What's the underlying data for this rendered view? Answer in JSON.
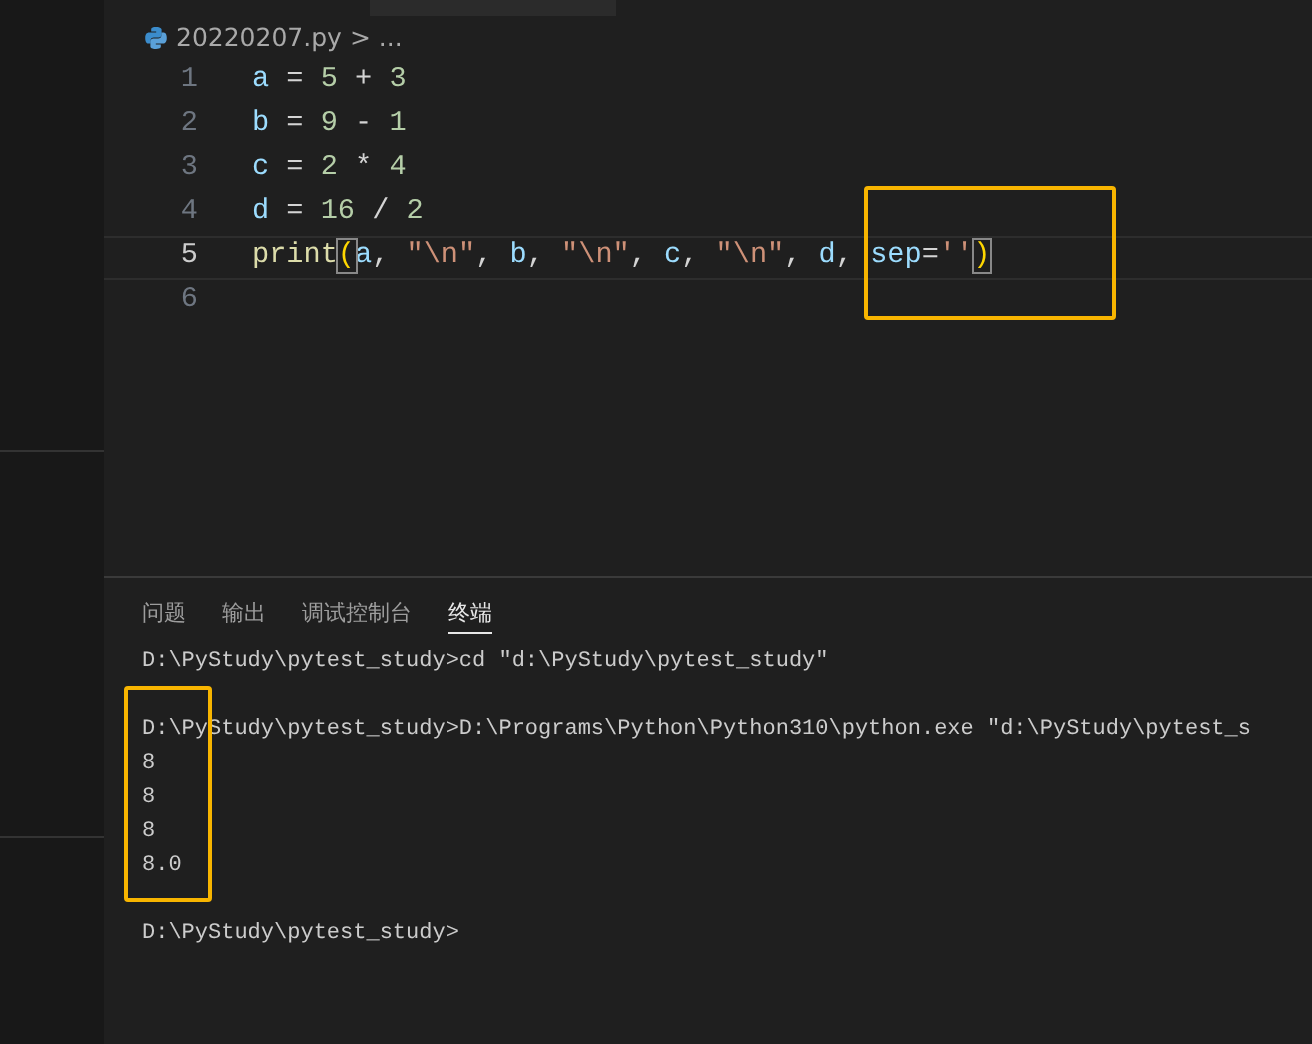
{
  "breadcrumb": {
    "file": "20220207.py",
    "separator": ">",
    "more": "..."
  },
  "editor": {
    "lines": [
      {
        "number": "1",
        "current": false,
        "tokens": [
          {
            "kind": "var",
            "text": "a"
          },
          {
            "kind": "op",
            "text": " = "
          },
          {
            "kind": "num",
            "text": "5"
          },
          {
            "kind": "op",
            "text": " + "
          },
          {
            "kind": "num",
            "text": "3"
          }
        ]
      },
      {
        "number": "2",
        "current": false,
        "tokens": [
          {
            "kind": "var",
            "text": "b"
          },
          {
            "kind": "op",
            "text": " = "
          },
          {
            "kind": "num",
            "text": "9"
          },
          {
            "kind": "op",
            "text": " - "
          },
          {
            "kind": "num",
            "text": "1"
          }
        ]
      },
      {
        "number": "3",
        "current": false,
        "tokens": [
          {
            "kind": "var",
            "text": "c"
          },
          {
            "kind": "op",
            "text": " = "
          },
          {
            "kind": "num",
            "text": "2"
          },
          {
            "kind": "op",
            "text": " * "
          },
          {
            "kind": "num",
            "text": "4"
          }
        ]
      },
      {
        "number": "4",
        "current": false,
        "tokens": [
          {
            "kind": "var",
            "text": "d"
          },
          {
            "kind": "op",
            "text": " = "
          },
          {
            "kind": "num",
            "text": "16"
          },
          {
            "kind": "op",
            "text": " / "
          },
          {
            "kind": "num",
            "text": "2"
          }
        ]
      },
      {
        "number": "5",
        "current": true,
        "tokens": [
          {
            "kind": "func",
            "text": "print"
          },
          {
            "kind": "bracket",
            "text": "("
          },
          {
            "kind": "var",
            "text": "a"
          },
          {
            "kind": "op",
            "text": ", "
          },
          {
            "kind": "str",
            "text": "\"\\n\""
          },
          {
            "kind": "op",
            "text": ", "
          },
          {
            "kind": "var",
            "text": "b"
          },
          {
            "kind": "op",
            "text": ", "
          },
          {
            "kind": "str",
            "text": "\"\\n\""
          },
          {
            "kind": "op",
            "text": ", "
          },
          {
            "kind": "var",
            "text": "c"
          },
          {
            "kind": "op",
            "text": ", "
          },
          {
            "kind": "str",
            "text": "\"\\n\""
          },
          {
            "kind": "op",
            "text": ", "
          },
          {
            "kind": "var",
            "text": "d"
          },
          {
            "kind": "op",
            "text": ", "
          },
          {
            "kind": "param",
            "text": "sep"
          },
          {
            "kind": "op",
            "text": "="
          },
          {
            "kind": "str",
            "text": "''"
          },
          {
            "kind": "bracket",
            "text": ")"
          }
        ]
      },
      {
        "number": "6",
        "current": false
      }
    ]
  },
  "panel": {
    "tabs": [
      {
        "label": "问题",
        "selected": false
      },
      {
        "label": "输出",
        "selected": false
      },
      {
        "label": "调试控制台",
        "selected": false
      },
      {
        "label": "终端",
        "selected": true
      }
    ],
    "terminal": {
      "blocks": [
        [
          "D:\\PyStudy\\pytest_study>cd \"d:\\PyStudy\\pytest_study\""
        ],
        [
          "D:\\PyStudy\\pytest_study>D:\\Programs\\Python\\Python310\\python.exe \"d:\\PyStudy\\pytest_s",
          "8",
          "8",
          "8",
          "8.0"
        ],
        [
          "D:\\PyStudy\\pytest_study>"
        ]
      ]
    }
  }
}
